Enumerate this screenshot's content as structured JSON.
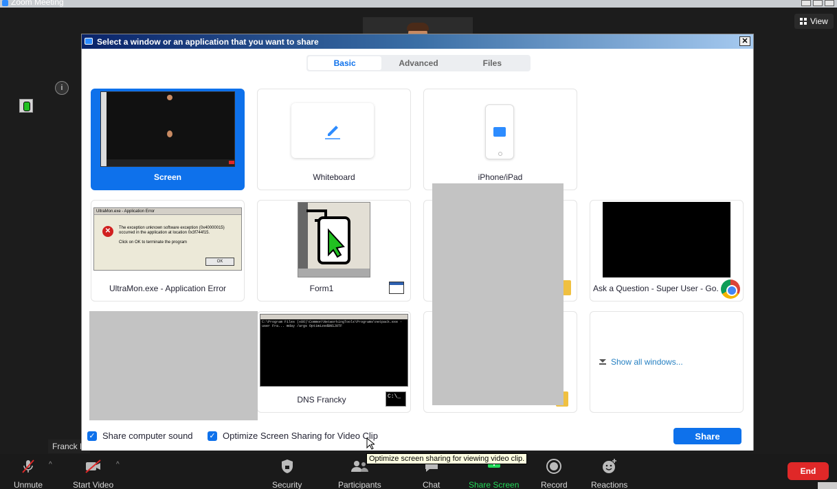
{
  "window": {
    "title": "Zoom Meeting"
  },
  "stage": {
    "view_label": "View",
    "participant_name": "Franck D"
  },
  "dialog": {
    "title": "Select a window or an application that you want to share",
    "tabs": [
      {
        "label": "Basic",
        "active": true
      },
      {
        "label": "Advanced",
        "active": false
      },
      {
        "label": "Files",
        "active": false
      }
    ],
    "cards": {
      "screen": "Screen",
      "whiteboard": "Whiteboard",
      "iphone": "iPhone/iPad",
      "ultramon": "UltraMon.exe - Application Error",
      "form1": "Form1",
      "chrome": "Ask a Question - Super User - Go...",
      "dns": "DNS Francky",
      "show_all": "Show all windows..."
    },
    "error_thumb": {
      "title": "UltraMon.exe - Application Error",
      "message": "The exception unknown software exception (0x40000015) occurred in the application at location 0x3f744f15.",
      "hint": "Click on OK to terminate the program",
      "ok": "OK"
    },
    "cmd_thumb": {
      "text": "C:\\Program Files (x86)\\Common\\NetworkingTools\\Programs\\netpack.exe -user Fra... mday /args OptimizedBNSJ0TF",
      "icon": "C:\\_"
    },
    "footer": {
      "share_sound": "Share computer sound",
      "optimize": "Optimize Screen Sharing for Video Clip",
      "share_button": "Share"
    }
  },
  "tooltip": "Optimize screen sharing for viewing video clip.",
  "toolbar": {
    "unmute": "Unmute",
    "start_video": "Start Video",
    "security": "Security",
    "participants": "Participants",
    "chat": "Chat",
    "share_screen": "Share Screen",
    "record": "Record",
    "reactions": "Reactions",
    "end": "End"
  },
  "colors": {
    "accent": "#0e71eb",
    "share_green": "#23d959",
    "end_red": "#e02828"
  }
}
